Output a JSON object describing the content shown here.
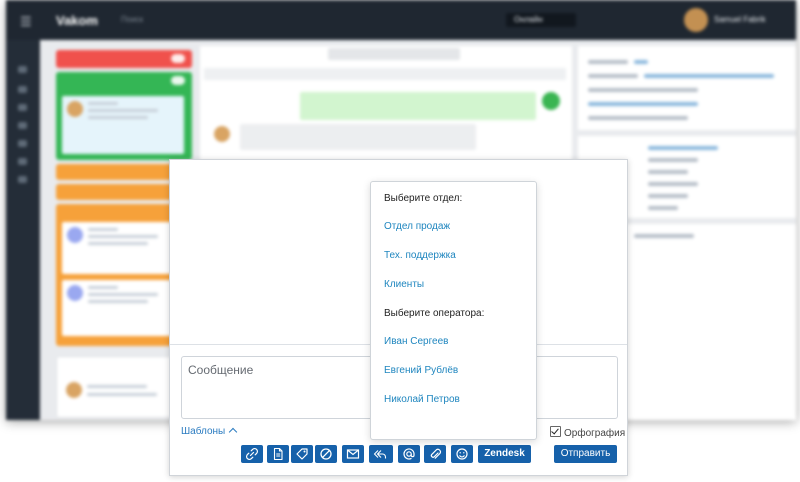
{
  "app": {
    "logo": "Vakom",
    "search_label": "Поиск",
    "status_label": "Онлайн",
    "user_name": "Samuel Fabrik"
  },
  "dropdown": {
    "department_heading": "Выберите отдел:",
    "departments": [
      "Отдел продаж",
      "Тех. поддержка",
      "Клиенты"
    ],
    "operator_heading": "Выберите оператора:",
    "operators": [
      "Иван Сергеев",
      "Евгений Рублёв",
      "Николай Петров"
    ]
  },
  "composer": {
    "message_placeholder": "Сообщение",
    "templates_label": "Шаблоны",
    "spellcheck_label": "Орфография",
    "spellcheck_checked": true,
    "zendesk_label": "Zendesk",
    "send_label": "Отправить"
  },
  "toolbar_icons": [
    "link-icon",
    "document-icon",
    "tag-icon",
    "block-icon",
    "mail-icon",
    "reply-all-icon",
    "at-icon",
    "attachment-icon",
    "smile-icon"
  ],
  "colors": {
    "accent_blue": "#1661aa",
    "link_blue": "#1f86bf",
    "card_red": "#f0514c",
    "card_green": "#34b655",
    "card_orange": "#f6a13a",
    "topbar": "#1f2731"
  }
}
